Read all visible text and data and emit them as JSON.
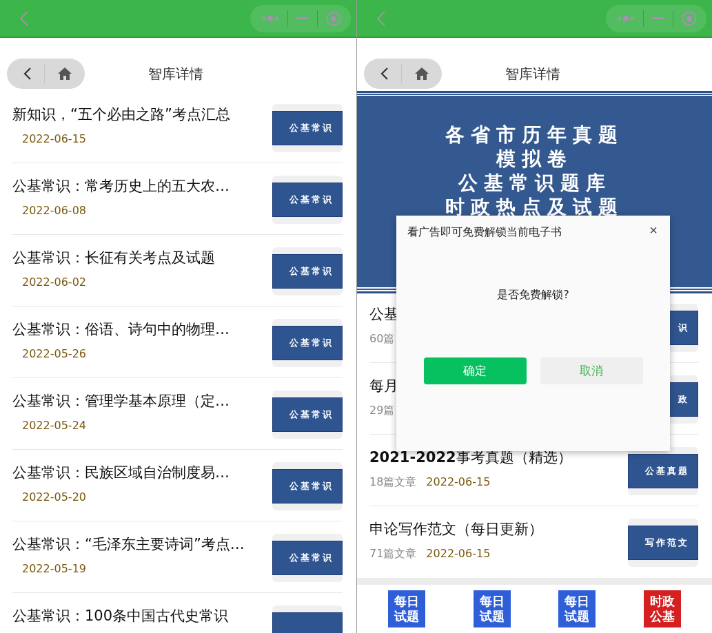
{
  "left": {
    "title": "智库详情",
    "articles": [
      {
        "title": "新知识，“五个必由之路”考点汇总",
        "date": "2022-06-15",
        "thumb": "公基常识"
      },
      {
        "title": "公基常识：常考历史上的五大农…",
        "date": "2022-06-08",
        "thumb": "公基常识"
      },
      {
        "title": "公基常识：长征有关考点及试题",
        "date": "2022-06-02",
        "thumb": "公基常识"
      },
      {
        "title": "公基常识：俗语、诗句中的物理…",
        "date": "2022-05-26",
        "thumb": "公基常识"
      },
      {
        "title": "公基常识：管理学基本原理（定…",
        "date": "2022-05-24",
        "thumb": "公基常识"
      },
      {
        "title": "公基常识：民族区域自治制度易…",
        "date": "2022-05-20",
        "thumb": "公基常识"
      },
      {
        "title": "公基常识：“毛泽东主要诗词”考点…",
        "date": "2022-05-19",
        "thumb": "公基常识"
      },
      {
        "title": "公基常识：100条中国古代史常识"
      }
    ]
  },
  "right": {
    "title": "智库详情",
    "banner": {
      "lines": [
        "各省市历年真题",
        "模拟卷",
        "公基常识题库",
        "时政热点及试题"
      ]
    },
    "books": [
      {
        "title": "公基",
        "count": "60篇",
        "thumb": "识"
      },
      {
        "title": "每月",
        "count": "29篇",
        "thumb": "政"
      },
      {
        "title": "**2021-2022**事考真题（精选）",
        "count": "18篇文章",
        "date": "2022-06-15",
        "thumb": "公基真题"
      },
      {
        "title": "申论写作范文（每日更新）",
        "count": "71篇文章",
        "date": "2022-06-15",
        "thumb": "写作范文"
      }
    ],
    "footer": [
      {
        "label": "每日试题",
        "color": "#2f5fd8"
      },
      {
        "label": "每日试题",
        "color": "#2f5fd8"
      },
      {
        "label": "每日试题",
        "color": "#2f5fd8"
      },
      {
        "label": "时政公基",
        "color": "#d42020"
      }
    ]
  },
  "dialog": {
    "title": "看广告即可免费解锁当前电子书",
    "close": "×",
    "message": "是否免费解锁?",
    "confirm": "确定",
    "cancel": "取消"
  }
}
